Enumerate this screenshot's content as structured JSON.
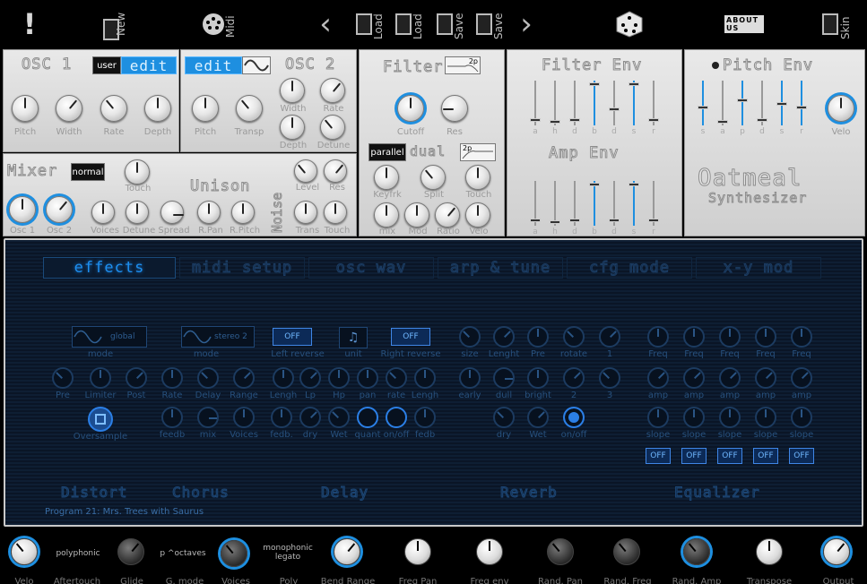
{
  "topbar": {
    "new": "New",
    "midi": "Midi",
    "load1": "Load",
    "load2": "Load",
    "save1": "Save",
    "save2": "Save",
    "skin": "Skin",
    "about": "ABOUT US"
  },
  "osc1": {
    "title": "OSC 1",
    "user_label": "user",
    "edit_label": "edit",
    "knobs": [
      "Pitch",
      "Width",
      "Rate",
      "Depth"
    ]
  },
  "osc2": {
    "title": "OSC 2",
    "edit_label": "edit",
    "knobs": [
      "Pitch",
      "Transp",
      "Width",
      "Rate",
      "Depth",
      "Detune"
    ]
  },
  "filter": {
    "title": "Filter",
    "mode": "2p",
    "knobs": [
      "Cutoff",
      "Res"
    ],
    "parallel_label": "parallel",
    "dual_label": "dual",
    "dual_mode": "2p",
    "knobs2": [
      "Keyfrk",
      "Split",
      "Touch",
      "mix",
      "Mod",
      "Ratio",
      "Velo"
    ]
  },
  "filter_env": {
    "title": "Filter Env",
    "labels": [
      "a",
      "h",
      "d",
      "b",
      "d",
      "s",
      "r"
    ]
  },
  "amp_env": {
    "title": "Amp Env",
    "labels": [
      "a",
      "h",
      "d",
      "b",
      "d",
      "s",
      "r"
    ]
  },
  "pitch_env": {
    "title": "Pitch Env",
    "labels": [
      "s",
      "a",
      "p",
      "d",
      "s",
      "r"
    ],
    "velo": "Velo"
  },
  "logo": {
    "line1": "Oatmeal",
    "line2": "Synthesizer"
  },
  "mixer": {
    "title": "Mixer",
    "mode": "normal",
    "touch": "Touch",
    "unison": "Unison",
    "noise": "Noise",
    "knobs": [
      "Osc 1",
      "Osc 2",
      "Voices",
      "Detune",
      "Spread",
      "R.Pan",
      "R.Pitch"
    ],
    "noise_knobs": [
      "Level",
      "Res",
      "Trans",
      "Touch"
    ]
  },
  "fx": {
    "tabs": [
      "effects",
      "midi setup",
      "osc wav",
      "arp & tune",
      "cfg mode",
      "x-y mod"
    ],
    "distort": {
      "mode_label": "mode",
      "mode_value": "global",
      "knobs": [
        "Pre",
        "Limiter",
        "Post"
      ],
      "oversample": "Oversample"
    },
    "chorus": {
      "mode_label": "mode",
      "mode_value": "stereo 2",
      "knobs": [
        "Rate",
        "Delay",
        "Range"
      ],
      "knobs2": [
        "feedb",
        "mix",
        "Voices"
      ]
    },
    "delay": {
      "left_reverse": "Left reverse",
      "unit": "unit",
      "right_reverse": "Right reverse",
      "off": "OFF",
      "knobs": [
        "Lengh",
        "Lp",
        "Hp",
        "pan",
        "rate",
        "Lengh"
      ],
      "knobs2": [
        "fedb.",
        "dry",
        "Wet",
        "quant",
        "on/off",
        "fedb"
      ]
    },
    "reverb": {
      "knobs": [
        "size",
        "Lenght",
        "Pre",
        "rotate",
        "1"
      ],
      "knobs2": [
        "early",
        "dull",
        "bright",
        "2",
        "3"
      ],
      "knobs3": [
        "dry",
        "Wet",
        "on/off"
      ]
    },
    "eq": {
      "freq": [
        "Freq",
        "Freq",
        "Freq",
        "Freq",
        "Freq"
      ],
      "amp": [
        "amp",
        "amp",
        "amp",
        "amp",
        "amp"
      ],
      "slope": [
        "slope",
        "slope",
        "slope",
        "slope",
        "slope"
      ],
      "off": [
        "OFF",
        "OFF",
        "OFF",
        "OFF",
        "OFF"
      ]
    },
    "sections": [
      "Distort",
      "Chorus",
      "Delay",
      "Reverb",
      "Equalizer"
    ],
    "program": "Program 21: Mrs. Trees with Saurus"
  },
  "bottom": {
    "labels": [
      "Velo",
      "Aftertouch",
      "Glide",
      "G. mode",
      "Voices",
      "Poly",
      "Bend Range",
      "Freq Pan",
      "Freq env",
      "Rand. Pan",
      "Rand. Freq",
      "Rand. Amp",
      "Transpose",
      "Output"
    ],
    "polyphonic": "polyphonic",
    "octaves": "p ^octaves",
    "mono1": "monophonic",
    "mono2": "legato"
  },
  "colors": {
    "accent": "#1e8fe0",
    "panel": "#d9d9d9",
    "fx_bg": "#0e1e33"
  }
}
